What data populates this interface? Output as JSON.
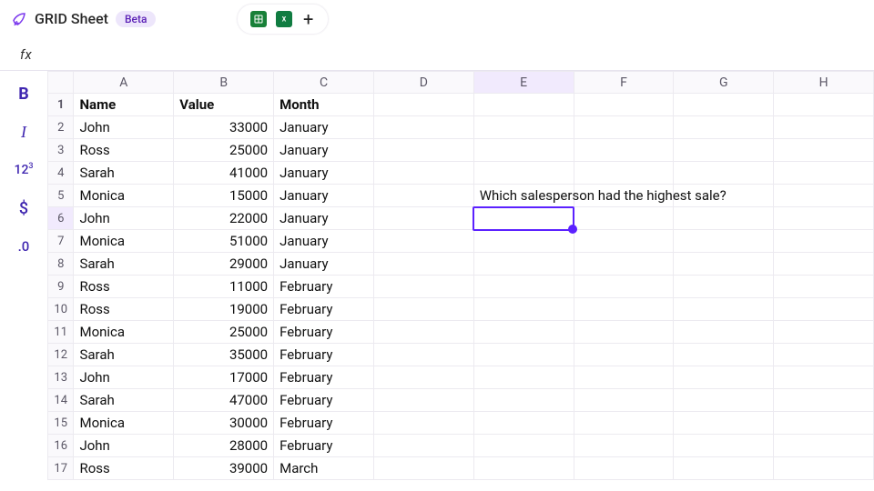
{
  "header": {
    "brand": "GRID Sheet",
    "badge": "Beta"
  },
  "formula_bar": {
    "fx_label": "fx",
    "value": ""
  },
  "tools": {
    "bold": "B",
    "italic": "I",
    "number": "123",
    "currency": "$",
    "decimal": ".0"
  },
  "columns": [
    "A",
    "B",
    "C",
    "D",
    "E",
    "F",
    "G",
    "H"
  ],
  "headers": {
    "A": "Name",
    "B": "Value",
    "C": "Month"
  },
  "rows": [
    {
      "n": 1,
      "A": "Name",
      "B": "Value",
      "C": "Month",
      "hdr": true
    },
    {
      "n": 2,
      "A": "John",
      "B": "33000",
      "C": "January"
    },
    {
      "n": 3,
      "A": "Ross",
      "B": "25000",
      "C": "January"
    },
    {
      "n": 4,
      "A": "Sarah",
      "B": "41000",
      "C": "January"
    },
    {
      "n": 5,
      "A": "Monica",
      "B": "15000",
      "C": "January",
      "E": "Which salesperson had the highest sale?"
    },
    {
      "n": 6,
      "A": "John",
      "B": "22000",
      "C": "January"
    },
    {
      "n": 7,
      "A": "Monica",
      "B": "51000",
      "C": "January"
    },
    {
      "n": 8,
      "A": "Sarah",
      "B": "29000",
      "C": "January"
    },
    {
      "n": 9,
      "A": "Ross",
      "B": "11000",
      "C": "February"
    },
    {
      "n": 10,
      "A": "Ross",
      "B": "19000",
      "C": "February"
    },
    {
      "n": 11,
      "A": "Monica",
      "B": "25000",
      "C": "February"
    },
    {
      "n": 12,
      "A": "Sarah",
      "B": "35000",
      "C": "February"
    },
    {
      "n": 13,
      "A": "John",
      "B": "17000",
      "C": "February"
    },
    {
      "n": 14,
      "A": "Sarah",
      "B": "47000",
      "C": "February"
    },
    {
      "n": 15,
      "A": "Monica",
      "B": "30000",
      "C": "February"
    },
    {
      "n": 16,
      "A": "John",
      "B": "28000",
      "C": "February"
    },
    {
      "n": 17,
      "A": "Ross",
      "B": "39000",
      "C": "March"
    }
  ],
  "selection": {
    "cell": "E6"
  }
}
